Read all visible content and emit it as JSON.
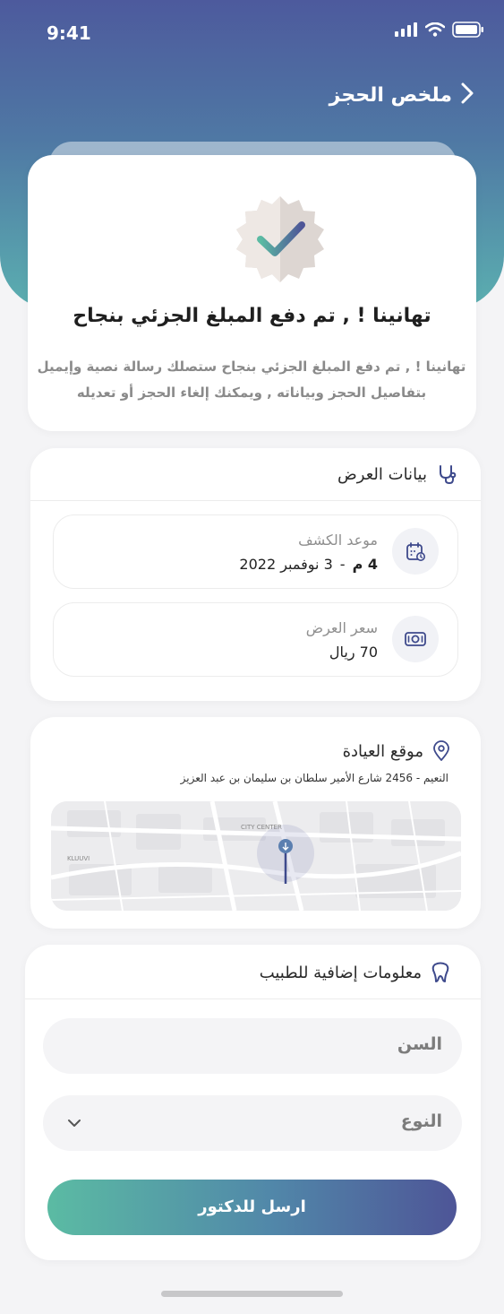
{
  "status": {
    "time": "9:41"
  },
  "header": {
    "title": "ملخص الحجز"
  },
  "success": {
    "title": "تهانينا ! , تم دفع المبلغ الجزئي بنجاح",
    "desc_line1": "تهانينا ! , تم دفع المبلغ الجزئي بنجاح ستصلك رسالة نصية وإيميل",
    "desc_line2": "بتفاصيل الحجز وبياناته , ويمكنك إلغاء الحجز أو تعديله"
  },
  "offer": {
    "section_title": "بيانات العرض",
    "appointment_label": "موعد الكشف",
    "appointment_time": "4 م",
    "appointment_sep": "-",
    "appointment_date": "3  نوفمبر 2022",
    "price_label": "سعر العرض",
    "price_value": "70 ريال"
  },
  "clinic": {
    "section_title": "موقع العيادة",
    "address": "النعيم - 2456 شارع الأمير سلطان بن سليمان بن عبد العزيز"
  },
  "doctor_info": {
    "section_title": "معلومات إضافية للطبيب",
    "age_placeholder": "السن",
    "gender_placeholder": "النوع",
    "submit_label": "ارسل للدكتور"
  },
  "map_labels": {
    "city_center": "CITY CENTER",
    "kluuvi": "KLUUVI"
  },
  "colors": {
    "gradient_top": "#4d5a9d",
    "gradient_bottom": "#5bafb0",
    "accent": "#4e5597"
  }
}
